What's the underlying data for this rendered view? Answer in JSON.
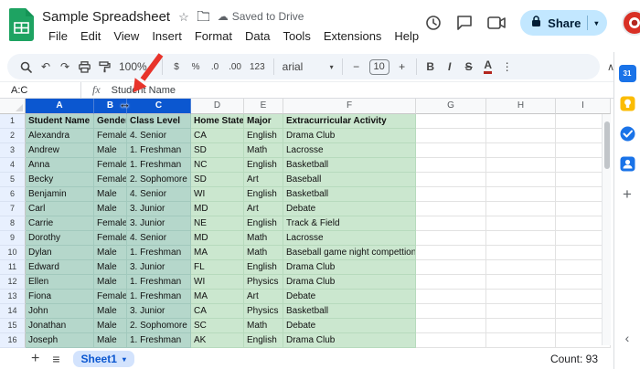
{
  "header": {
    "title": "Sample Spreadsheet",
    "saved_status": "Saved to Drive",
    "menus": [
      "File",
      "Edit",
      "View",
      "Insert",
      "Format",
      "Data",
      "Tools",
      "Extensions",
      "Help"
    ],
    "share_label": "Share"
  },
  "toolbar": {
    "zoom": "100%",
    "currency": "$",
    "percent": "%",
    "decimal_decrease": ".0",
    "decimal_increase": ".00",
    "format_123": "123",
    "font_name": "arial",
    "minus": "−",
    "font_size": "10",
    "plus": "+",
    "bold": "B",
    "italic": "I",
    "strikethrough": "S",
    "text_color": "A",
    "more": "⋮",
    "undo": "↶",
    "redo": "↷"
  },
  "formula_bar": {
    "name_box": "A:C",
    "fx_label": "fx",
    "content": "Student Name"
  },
  "grid": {
    "column_letters": [
      "A",
      "B",
      "C",
      "D",
      "E",
      "F",
      "G",
      "H",
      "I"
    ],
    "selected_columns": [
      "A",
      "B",
      "C"
    ],
    "rows": [
      {
        "num": 1,
        "cells": [
          "Student Name",
          "Gender",
          "Class Level",
          "Home State",
          "Major",
          "Extracurricular Activity"
        ]
      },
      {
        "num": 2,
        "cells": [
          "Alexandra",
          "Female",
          "4. Senior",
          "CA",
          "English",
          "Drama Club"
        ]
      },
      {
        "num": 3,
        "cells": [
          "Andrew",
          "Male",
          "1. Freshman",
          "SD",
          "Math",
          "Lacrosse"
        ]
      },
      {
        "num": 4,
        "cells": [
          "Anna",
          "Female",
          "1. Freshman",
          "NC",
          "English",
          "Basketball"
        ]
      },
      {
        "num": 5,
        "cells": [
          "Becky",
          "Female",
          "2. Sophomore",
          "SD",
          "Art",
          "Baseball"
        ]
      },
      {
        "num": 6,
        "cells": [
          "Benjamin",
          "Male",
          "4. Senior",
          "WI",
          "English",
          "Basketball"
        ]
      },
      {
        "num": 7,
        "cells": [
          "Carl",
          "Male",
          "3. Junior",
          "MD",
          "Art",
          "Debate"
        ]
      },
      {
        "num": 8,
        "cells": [
          "Carrie",
          "Female",
          "3. Junior",
          "NE",
          "English",
          "Track & Field"
        ]
      },
      {
        "num": 9,
        "cells": [
          "Dorothy",
          "Female",
          "4. Senior",
          "MD",
          "Math",
          "Lacrosse"
        ]
      },
      {
        "num": 10,
        "cells": [
          "Dylan",
          "Male",
          "1. Freshman",
          "MA",
          "Math",
          "Baseball game night compettion"
        ]
      },
      {
        "num": 11,
        "cells": [
          "Edward",
          "Male",
          "3. Junior",
          "FL",
          "English",
          "Drama Club"
        ]
      },
      {
        "num": 12,
        "cells": [
          "Ellen",
          "Male",
          "1. Freshman",
          "WI",
          "Physics",
          "Drama Club"
        ]
      },
      {
        "num": 13,
        "cells": [
          "Fiona",
          "Female",
          "1. Freshman",
          "MA",
          "Art",
          "Debate"
        ]
      },
      {
        "num": 14,
        "cells": [
          "John",
          "Male",
          "3. Junior",
          "CA",
          "Physics",
          "Basketball"
        ]
      },
      {
        "num": 15,
        "cells": [
          "Jonathan",
          "Male",
          "2. Sophomore",
          "SC",
          "Math",
          "Debate"
        ]
      },
      {
        "num": 16,
        "cells": [
          "Joseph",
          "Male",
          "1. Freshman",
          "AK",
          "English",
          "Drama Club"
        ]
      }
    ]
  },
  "sheet_bar": {
    "add": "+",
    "all_sheets": "≡",
    "sheet_name": "Sheet1",
    "count": "Count: 93"
  },
  "side_panel": {
    "calendar_label": "31"
  },
  "colors": {
    "accent_blue": "#0b57d0",
    "selected_header": "#0b57d0",
    "selection_fill": "#b5d7cb",
    "table_green": "#cbe7cf",
    "share_pill": "#c2e7ff",
    "annotation_red": "#e8332a"
  }
}
